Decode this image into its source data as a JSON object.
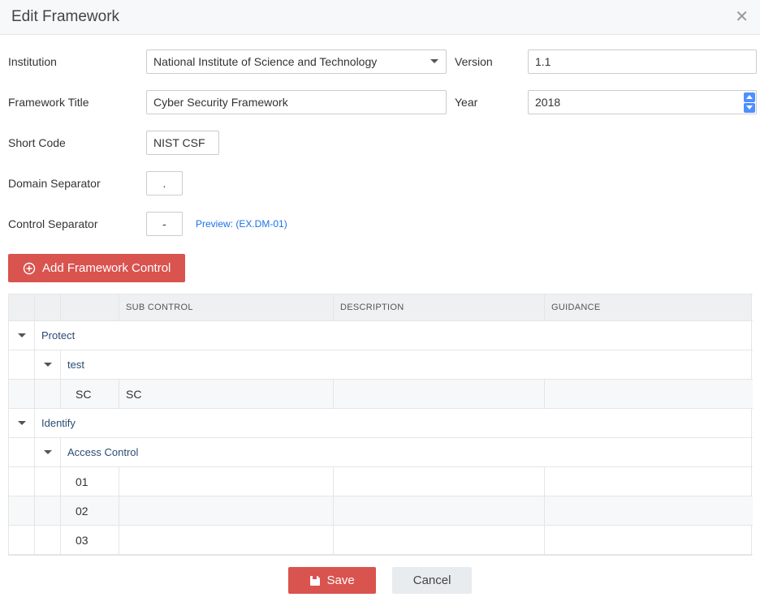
{
  "dialog": {
    "title": "Edit Framework",
    "close_symbol": "✕"
  },
  "form": {
    "institution_label": "Institution",
    "institution_value": "National Institute of Science and Technology",
    "version_label": "Version",
    "version_value": "1.1",
    "title_label": "Framework Title",
    "title_value": "Cyber Security Framework",
    "year_label": "Year",
    "year_value": "2018",
    "short_code_label": "Short Code",
    "short_code_value": "NIST CSF",
    "domain_sep_label": "Domain Separator",
    "domain_sep_value": ".",
    "control_sep_label": "Control Separator",
    "control_sep_value": "-",
    "preview_label": "Preview: (EX.DM-01)"
  },
  "toolbar": {
    "add_control_label": "Add Framework Control"
  },
  "grid": {
    "headers": {
      "sub_control": "SUB CONTROL",
      "description": "DESCRIPTION",
      "guidance": "GUIDANCE"
    },
    "rows": {
      "domainA": "Protect",
      "domainA_sub1": "test",
      "domainA_sub1_code": "SC",
      "domainA_sub1_sc": "SC",
      "domainB": "Identify",
      "domainB_sub1": "Access Control",
      "domainB_sub1_r1": "01",
      "domainB_sub1_r2": "02",
      "domainB_sub1_r3": "03"
    }
  },
  "footer": {
    "save_label": "Save",
    "cancel_label": "Cancel"
  }
}
